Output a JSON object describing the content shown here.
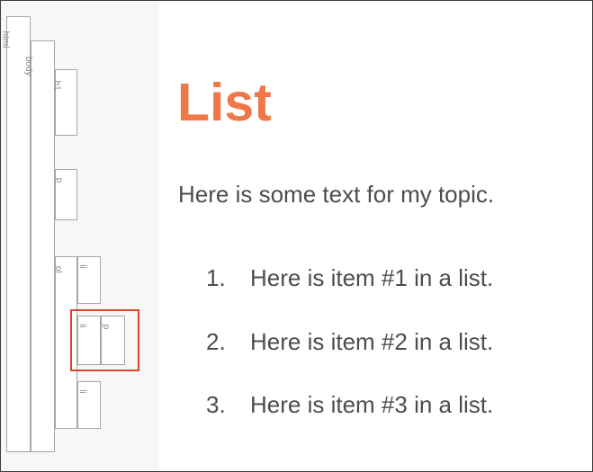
{
  "structure_tags": {
    "html": "html",
    "body": "body",
    "h1": "h1",
    "p": "p",
    "ol": "ol",
    "li_1": "li",
    "li_2": "li",
    "li_2_p": "p",
    "li_3": "li"
  },
  "content": {
    "title": "List",
    "intro": "Here is some text for my topic.",
    "list_items": [
      {
        "number": "1.",
        "text": "Here is item #1 in a list."
      },
      {
        "number": "2.",
        "text": "Here is item #2 in a list."
      },
      {
        "number": "3.",
        "text": "Here is item #3 in a list."
      }
    ]
  },
  "colors": {
    "title": "#f07848",
    "body_text": "#4d4d4d",
    "highlight": "#d9452d",
    "tag_border": "#a6a6a6"
  }
}
